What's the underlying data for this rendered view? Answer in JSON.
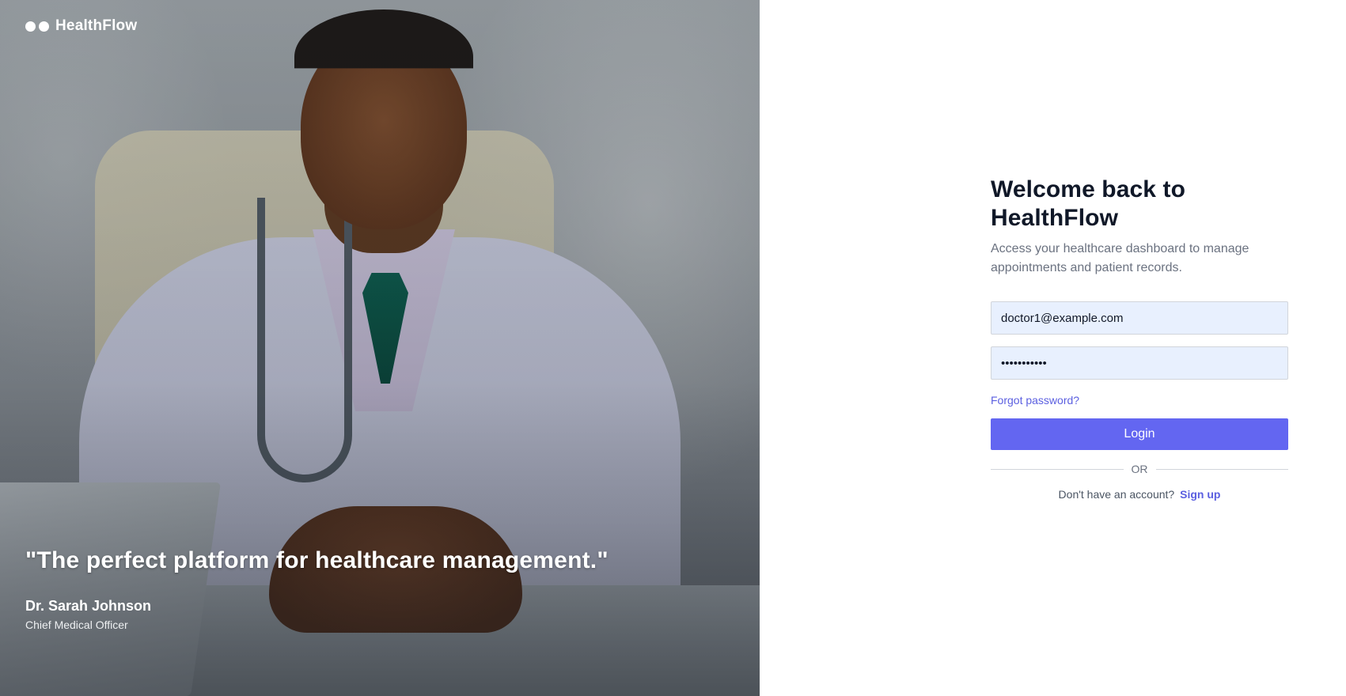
{
  "brand": {
    "name": "HealthFlow"
  },
  "hero": {
    "image_alt": "Smiling doctor in white coat with stethoscope sitting at a desk",
    "quote": "\"The perfect platform for healthcare management.\"",
    "author_name": "Dr. Sarah Johnson",
    "author_role": "Chief Medical Officer"
  },
  "login": {
    "title_line1": "Welcome back to",
    "title_line2": "HealthFlow",
    "subtitle_line1": "Access your healthcare dashboard to manage",
    "subtitle_line2": "appointments and patient records.",
    "email_value": "doctor1@example.com",
    "password_value": "•••••••••••",
    "forgot_label": "Forgot password?",
    "login_label": "Login",
    "divider_label": "OR",
    "signup_prompt": "Don't have an account?",
    "signup_label": "Sign up"
  },
  "colors": {
    "accent": "#6366f1",
    "link": "#5b5fe0",
    "input_background": "#e8f0fe",
    "title": "#101828",
    "muted_text": "#6b7280"
  }
}
